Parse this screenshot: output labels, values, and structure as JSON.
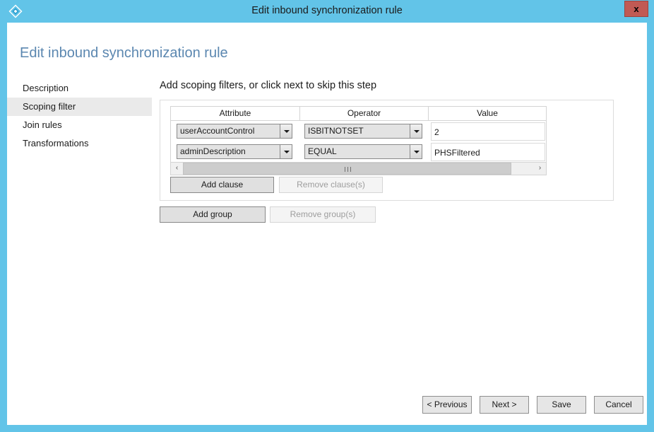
{
  "window": {
    "title": "Edit inbound synchronization rule",
    "icon": "azure-diamond-icon",
    "close_label": "x",
    "titlebar_color": "#62c4e8",
    "close_color": "#c15a54"
  },
  "page": {
    "title": "Edit inbound synchronization rule",
    "title_color": "#5b87b0"
  },
  "sidebar": {
    "items": [
      {
        "label": "Description",
        "selected": false
      },
      {
        "label": "Scoping filter",
        "selected": true
      },
      {
        "label": "Join rules",
        "selected": false
      },
      {
        "label": "Transformations",
        "selected": false
      }
    ],
    "selected_highlight": "#eaeaea"
  },
  "main": {
    "step_heading": "Add scoping filters, or click next to skip this step",
    "table": {
      "columns": [
        "Attribute",
        "Operator",
        "Value"
      ],
      "rows": [
        {
          "attribute": "userAccountControl",
          "operator": "ISBITNOTSET",
          "value": "2"
        },
        {
          "attribute": "adminDescription",
          "operator": "EQUAL",
          "value": "PHSFiltered"
        }
      ]
    },
    "scrollbar": {
      "left_arrow": "‹",
      "right_arrow": "›",
      "grip": "III"
    },
    "clause_buttons": {
      "add": {
        "label": "Add clause",
        "enabled": true
      },
      "remove": {
        "label": "Remove clause(s)",
        "enabled": false
      }
    },
    "group_buttons": {
      "add": {
        "label": "Add group",
        "enabled": true
      },
      "remove": {
        "label": "Remove group(s)",
        "enabled": false
      }
    }
  },
  "footer": {
    "buttons": [
      {
        "label": "< Previous"
      },
      {
        "label": "Next >"
      },
      {
        "label": "Save"
      },
      {
        "label": "Cancel"
      }
    ]
  }
}
